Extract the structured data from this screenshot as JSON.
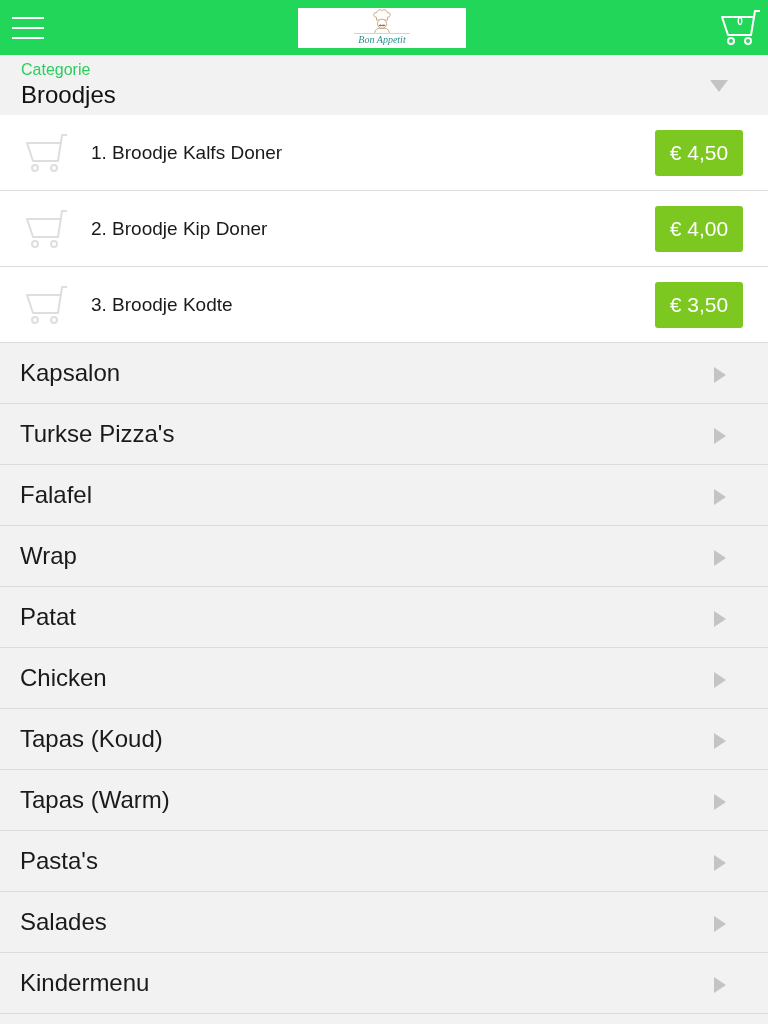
{
  "header": {
    "logo_text": "Bon Appetit",
    "cart_count": "0"
  },
  "category_label": "Categorie",
  "categories": [
    {
      "name": "Broodjes",
      "expanded": true,
      "products": [
        {
          "name": "1. Broodje Kalfs Doner",
          "price": "€ 4,50"
        },
        {
          "name": "2. Broodje Kip Doner",
          "price": "€ 4,00"
        },
        {
          "name": "3. Broodje Kodte",
          "price": "€ 3,50"
        }
      ]
    },
    {
      "name": "Kapsalon",
      "expanded": false
    },
    {
      "name": "Turkse Pizza's",
      "expanded": false
    },
    {
      "name": "Falafel",
      "expanded": false
    },
    {
      "name": "Wrap",
      "expanded": false
    },
    {
      "name": "Patat",
      "expanded": false
    },
    {
      "name": "Chicken",
      "expanded": false
    },
    {
      "name": "Tapas (Koud)",
      "expanded": false
    },
    {
      "name": "Tapas (Warm)",
      "expanded": false
    },
    {
      "name": "Pasta's",
      "expanded": false
    },
    {
      "name": "Salades",
      "expanded": false
    },
    {
      "name": "Kindermenu",
      "expanded": false
    }
  ]
}
